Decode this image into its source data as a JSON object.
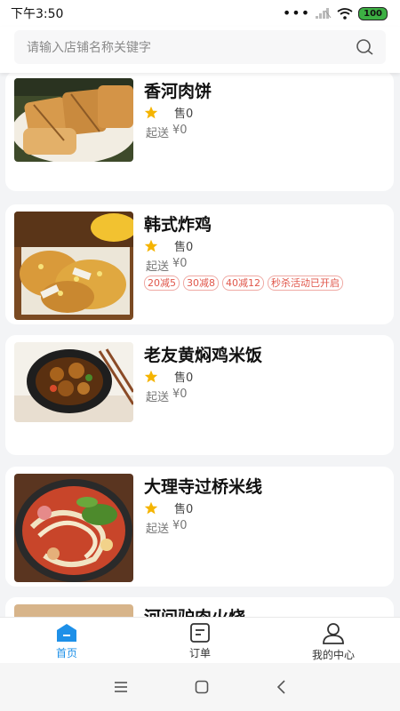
{
  "status_bar": {
    "time": "下午3:50",
    "battery": "100"
  },
  "search": {
    "placeholder": "请输入店铺名称关键字"
  },
  "shops": [
    {
      "name": "香河肉饼",
      "sold": "售0",
      "min_label": "起送",
      "min_value": "¥0",
      "tags": []
    },
    {
      "name": "韩式炸鸡",
      "sold": "售0",
      "min_label": "起送",
      "min_value": "¥0",
      "tags": [
        "20减5",
        "30减8",
        "40减12",
        "秒杀活动已开启"
      ]
    },
    {
      "name": "老友黄焖鸡米饭",
      "sold": "售0",
      "min_label": "起送",
      "min_value": "¥0",
      "tags": []
    },
    {
      "name": "大理寺过桥米线",
      "sold": "售0",
      "min_label": "起送",
      "min_value": "¥0",
      "tags": []
    },
    {
      "name": "河间驴肉火烧",
      "sold": "",
      "min_label": "",
      "min_value": "",
      "tags": []
    }
  ],
  "nav": {
    "home": "首页",
    "orders": "订单",
    "profile": "我的中心"
  },
  "colors": {
    "accent": "#1e90e8",
    "star": "#f5b400",
    "tag": "#e0564a"
  }
}
